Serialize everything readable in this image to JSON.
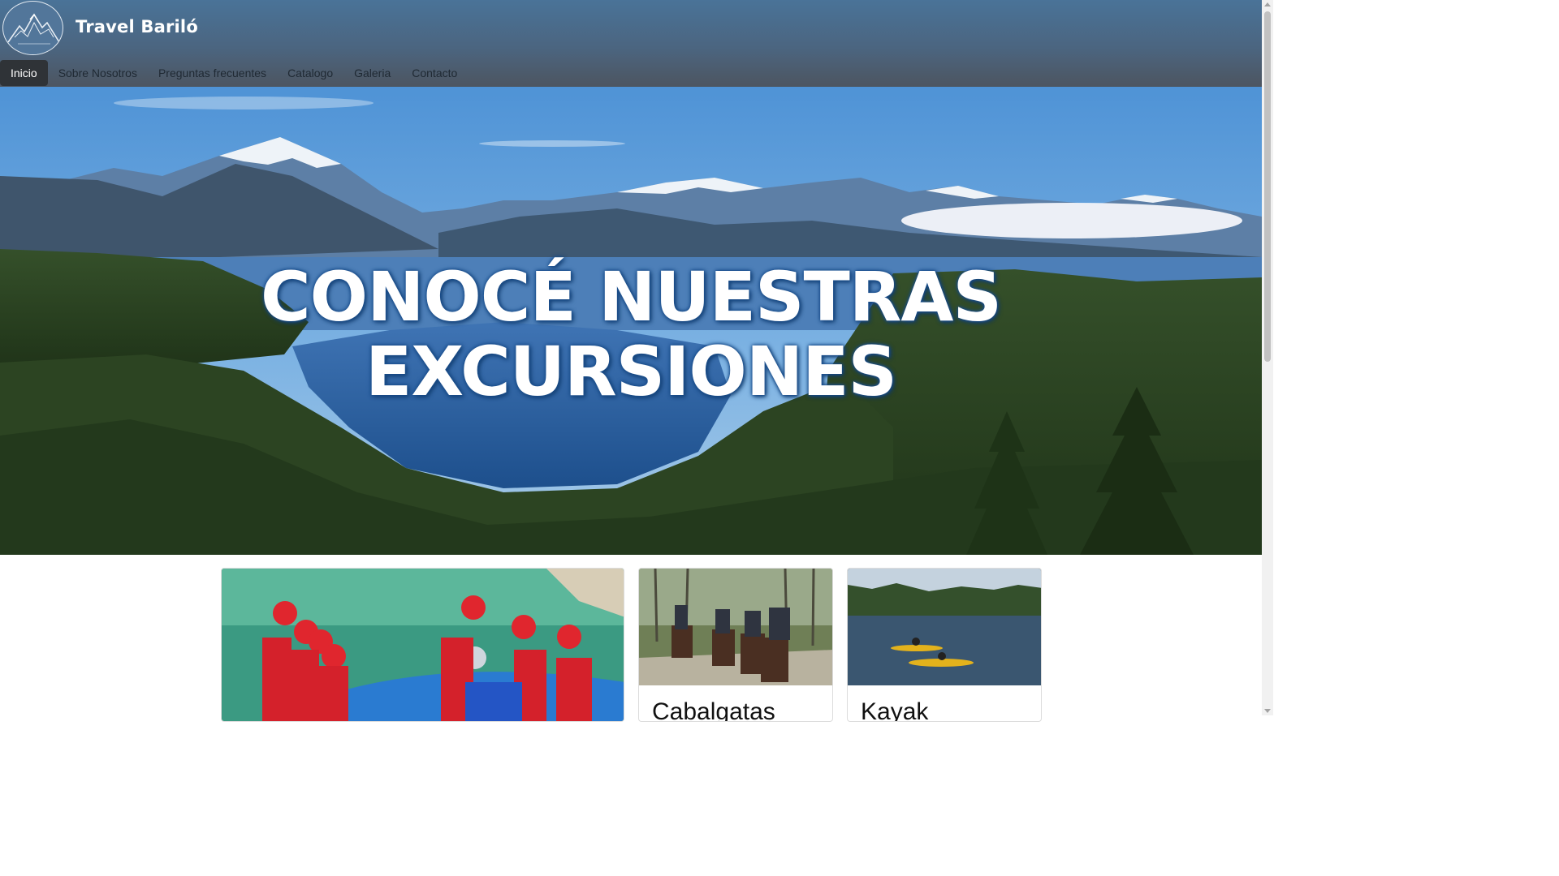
{
  "brand": {
    "name": "Travel Bariló",
    "logo_icon": "mountain-logo-icon"
  },
  "nav": {
    "items": [
      {
        "label": "Inicio",
        "active": true
      },
      {
        "label": "Sobre Nosotros",
        "active": false
      },
      {
        "label": "Preguntas frecuentes",
        "active": false
      },
      {
        "label": "Catalogo",
        "active": false
      },
      {
        "label": "Galeria",
        "active": false
      },
      {
        "label": "Contacto",
        "active": false
      }
    ]
  },
  "hero": {
    "line1": "CONOCÉ NUESTRAS",
    "line2": "EXCURSIONES",
    "image": "lake-mountains-landscape"
  },
  "cards": [
    {
      "title": "",
      "image": "rafting-photo"
    },
    {
      "title": "Cabalgatas",
      "image": "horseback-riding-photo"
    },
    {
      "title": "Kayak",
      "image": "kayak-lake-photo"
    }
  ],
  "colors": {
    "header_top": "#4a7398",
    "header_bottom": "#4d5560",
    "nav_active_bg": "#2f3337",
    "hero_text_outline": "#1a4f8f"
  }
}
